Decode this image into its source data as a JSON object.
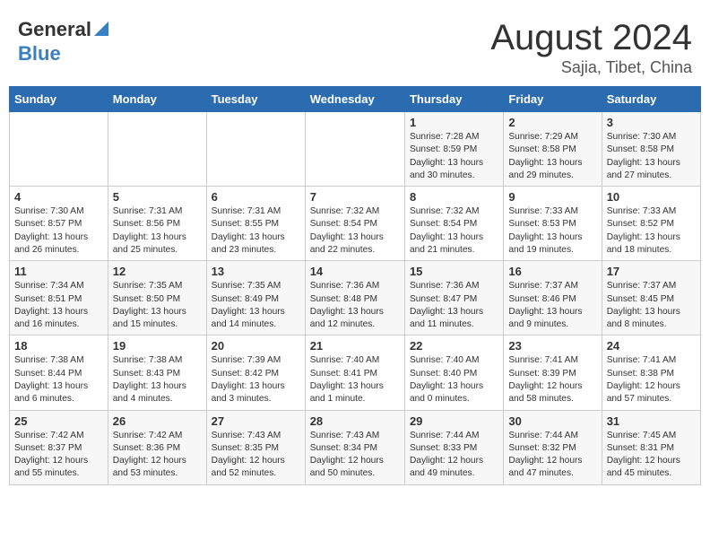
{
  "header": {
    "logo_general": "General",
    "logo_blue": "Blue",
    "month": "August 2024",
    "location": "Sajia, Tibet, China"
  },
  "weekdays": [
    "Sunday",
    "Monday",
    "Tuesday",
    "Wednesday",
    "Thursday",
    "Friday",
    "Saturday"
  ],
  "weeks": [
    [
      {
        "day": "",
        "info": ""
      },
      {
        "day": "",
        "info": ""
      },
      {
        "day": "",
        "info": ""
      },
      {
        "day": "",
        "info": ""
      },
      {
        "day": "1",
        "info": "Sunrise: 7:28 AM\nSunset: 8:59 PM\nDaylight: 13 hours and 30 minutes."
      },
      {
        "day": "2",
        "info": "Sunrise: 7:29 AM\nSunset: 8:58 PM\nDaylight: 13 hours and 29 minutes."
      },
      {
        "day": "3",
        "info": "Sunrise: 7:30 AM\nSunset: 8:58 PM\nDaylight: 13 hours and 27 minutes."
      }
    ],
    [
      {
        "day": "4",
        "info": "Sunrise: 7:30 AM\nSunset: 8:57 PM\nDaylight: 13 hours and 26 minutes."
      },
      {
        "day": "5",
        "info": "Sunrise: 7:31 AM\nSunset: 8:56 PM\nDaylight: 13 hours and 25 minutes."
      },
      {
        "day": "6",
        "info": "Sunrise: 7:31 AM\nSunset: 8:55 PM\nDaylight: 13 hours and 23 minutes."
      },
      {
        "day": "7",
        "info": "Sunrise: 7:32 AM\nSunset: 8:54 PM\nDaylight: 13 hours and 22 minutes."
      },
      {
        "day": "8",
        "info": "Sunrise: 7:32 AM\nSunset: 8:54 PM\nDaylight: 13 hours and 21 minutes."
      },
      {
        "day": "9",
        "info": "Sunrise: 7:33 AM\nSunset: 8:53 PM\nDaylight: 13 hours and 19 minutes."
      },
      {
        "day": "10",
        "info": "Sunrise: 7:33 AM\nSunset: 8:52 PM\nDaylight: 13 hours and 18 minutes."
      }
    ],
    [
      {
        "day": "11",
        "info": "Sunrise: 7:34 AM\nSunset: 8:51 PM\nDaylight: 13 hours and 16 minutes."
      },
      {
        "day": "12",
        "info": "Sunrise: 7:35 AM\nSunset: 8:50 PM\nDaylight: 13 hours and 15 minutes."
      },
      {
        "day": "13",
        "info": "Sunrise: 7:35 AM\nSunset: 8:49 PM\nDaylight: 13 hours and 14 minutes."
      },
      {
        "day": "14",
        "info": "Sunrise: 7:36 AM\nSunset: 8:48 PM\nDaylight: 13 hours and 12 minutes."
      },
      {
        "day": "15",
        "info": "Sunrise: 7:36 AM\nSunset: 8:47 PM\nDaylight: 13 hours and 11 minutes."
      },
      {
        "day": "16",
        "info": "Sunrise: 7:37 AM\nSunset: 8:46 PM\nDaylight: 13 hours and 9 minutes."
      },
      {
        "day": "17",
        "info": "Sunrise: 7:37 AM\nSunset: 8:45 PM\nDaylight: 13 hours and 8 minutes."
      }
    ],
    [
      {
        "day": "18",
        "info": "Sunrise: 7:38 AM\nSunset: 8:44 PM\nDaylight: 13 hours and 6 minutes."
      },
      {
        "day": "19",
        "info": "Sunrise: 7:38 AM\nSunset: 8:43 PM\nDaylight: 13 hours and 4 minutes."
      },
      {
        "day": "20",
        "info": "Sunrise: 7:39 AM\nSunset: 8:42 PM\nDaylight: 13 hours and 3 minutes."
      },
      {
        "day": "21",
        "info": "Sunrise: 7:40 AM\nSunset: 8:41 PM\nDaylight: 13 hours and 1 minute."
      },
      {
        "day": "22",
        "info": "Sunrise: 7:40 AM\nSunset: 8:40 PM\nDaylight: 13 hours and 0 minutes."
      },
      {
        "day": "23",
        "info": "Sunrise: 7:41 AM\nSunset: 8:39 PM\nDaylight: 12 hours and 58 minutes."
      },
      {
        "day": "24",
        "info": "Sunrise: 7:41 AM\nSunset: 8:38 PM\nDaylight: 12 hours and 57 minutes."
      }
    ],
    [
      {
        "day": "25",
        "info": "Sunrise: 7:42 AM\nSunset: 8:37 PM\nDaylight: 12 hours and 55 minutes."
      },
      {
        "day": "26",
        "info": "Sunrise: 7:42 AM\nSunset: 8:36 PM\nDaylight: 12 hours and 53 minutes."
      },
      {
        "day": "27",
        "info": "Sunrise: 7:43 AM\nSunset: 8:35 PM\nDaylight: 12 hours and 52 minutes."
      },
      {
        "day": "28",
        "info": "Sunrise: 7:43 AM\nSunset: 8:34 PM\nDaylight: 12 hours and 50 minutes."
      },
      {
        "day": "29",
        "info": "Sunrise: 7:44 AM\nSunset: 8:33 PM\nDaylight: 12 hours and 49 minutes."
      },
      {
        "day": "30",
        "info": "Sunrise: 7:44 AM\nSunset: 8:32 PM\nDaylight: 12 hours and 47 minutes."
      },
      {
        "day": "31",
        "info": "Sunrise: 7:45 AM\nSunset: 8:31 PM\nDaylight: 12 hours and 45 minutes."
      }
    ]
  ]
}
